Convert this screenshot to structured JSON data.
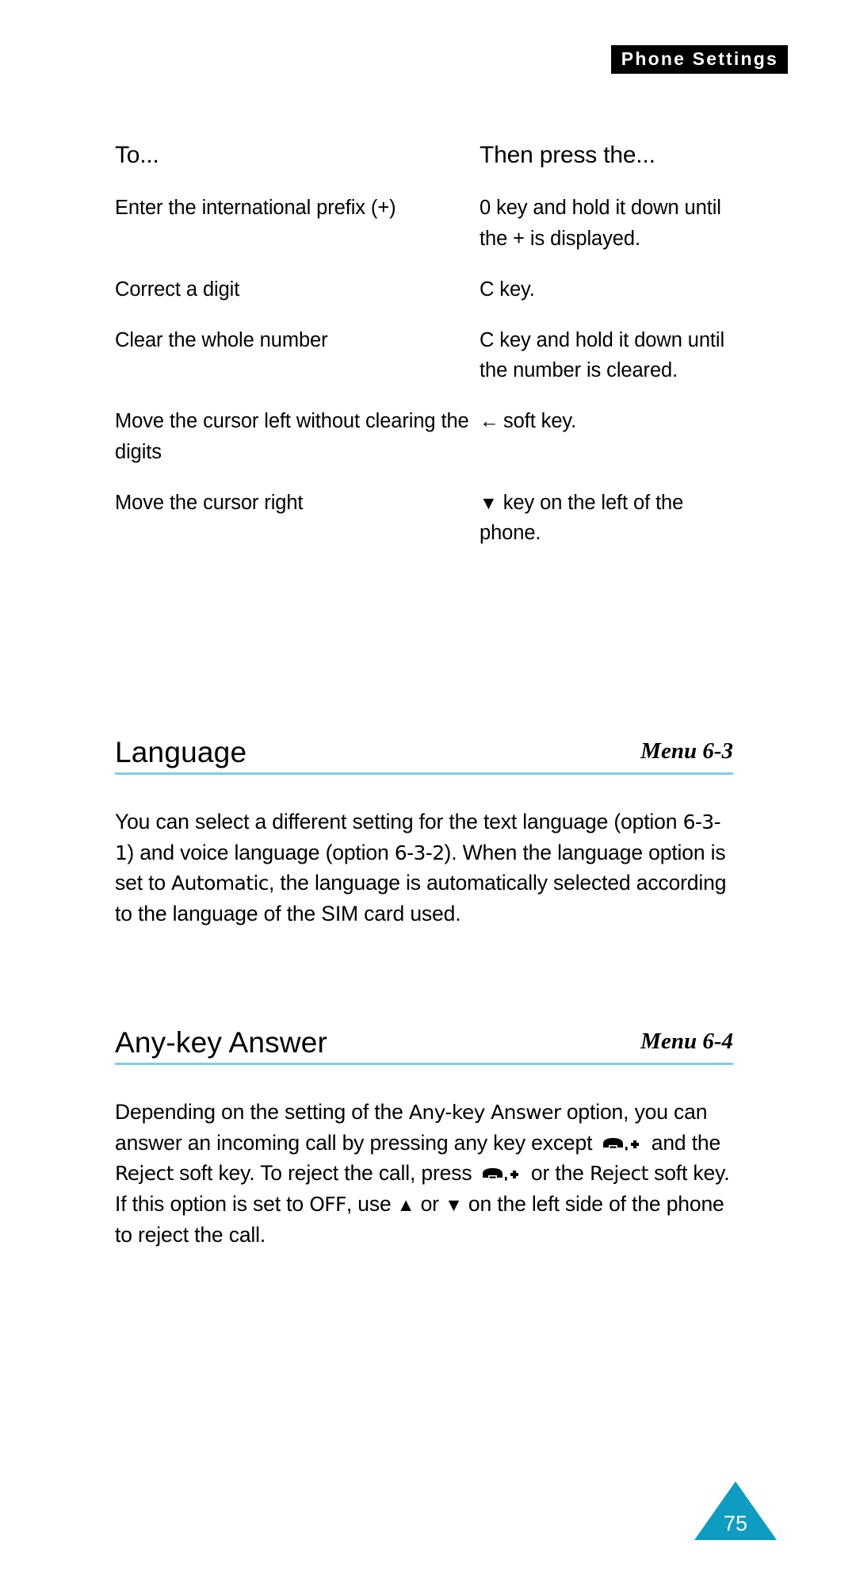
{
  "running_head": "Phone Settings",
  "table": {
    "headers": [
      "To...",
      "Then press the..."
    ],
    "rows": [
      {
        "to": "Enter the international prefix (+)",
        "press_prefix": "",
        "press": "0 key and hold it down until the + is displayed."
      },
      {
        "to": "Correct a digit",
        "press_prefix": "",
        "press": "C key."
      },
      {
        "to": "Clear the whole number",
        "press_prefix": "",
        "press": "C key and hold it down until the number is cleared."
      },
      {
        "to": "Move the cursor left without clearing the digits",
        "press_prefix": "←",
        "press": "soft key."
      },
      {
        "to": "Move the cursor right",
        "press_prefix": "▼",
        "press": "key on the left of the phone."
      }
    ]
  },
  "sections": [
    {
      "title": "Language",
      "menu": "Menu 6-3",
      "body": {
        "part1": "You can select a different setting for the text language (option ",
        "em1": "6-3-1",
        "part2": ") and voice language (option ",
        "em2": "6-3-2",
        "part3": "). When the language option is set to ",
        "em3": "Automatic",
        "part4": ", the language is automatically selected according to the language of the SIM card used."
      }
    },
    {
      "title": "Any-key Answer",
      "menu": "Menu 6-4",
      "body": {
        "part1": "Depending on the setting of the ",
        "em1": "Any-key Answer",
        "part2": " option, you can answer an incoming call by pressing any key except ",
        "icon1": "phone-key-icon",
        "part3": " and the ",
        "em2": "Reject",
        "part4": " soft key. To reject the call, press ",
        "icon2": "phone-key-icon",
        "part5": " or the ",
        "em3": "Reject",
        "part6": " soft key. If this option is set to ",
        "em4": "OFF",
        "part7": ", use ",
        "icon3": "▲",
        "part8": " or ",
        "icon4": "▼",
        "part9": " on the left side of the phone to reject the call."
      }
    }
  ],
  "page_number": "75",
  "colors": {
    "rule": "#7ecfe4",
    "badge": "#0e9dc0",
    "running_head_bg": "#000000"
  }
}
